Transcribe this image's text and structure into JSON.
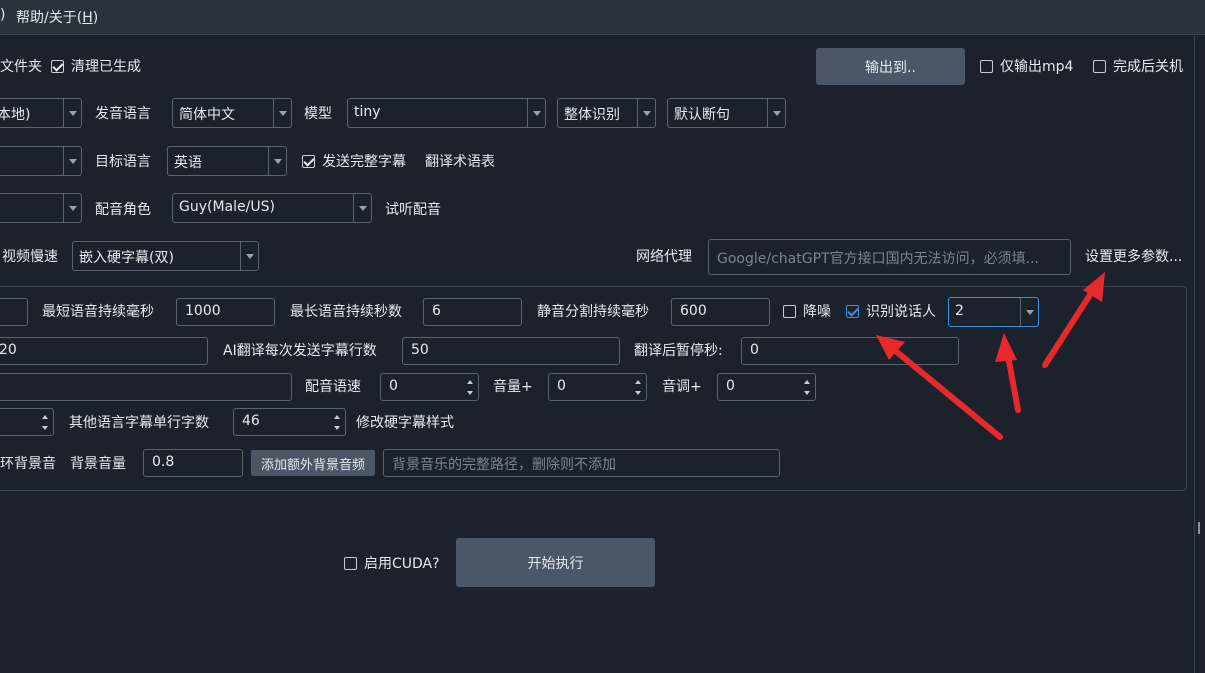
{
  "menubar": {
    "prefix": ")",
    "help": "帮助/关于(",
    "help_key": "H",
    "help_suffix": ")"
  },
  "row1": {
    "folder_label": "文件夹",
    "clean_checkbox": {
      "label": "清理已生成",
      "checked": true
    },
    "output_button": "输出到..",
    "only_mp4": {
      "label": "仅输出mp4",
      "checked": false
    },
    "shutdown": {
      "label": "完成后关机",
      "checked": false
    }
  },
  "row2": {
    "mode_combo": "本地)",
    "lang_label": "发音语言",
    "lang_combo": "简体中文",
    "model_label": "模型",
    "model_combo": "tiny",
    "recog_combo": "整体识别",
    "split_combo": "默认断句"
  },
  "row3": {
    "target_label": "目标语言",
    "target_combo": "英语",
    "send_full": {
      "label": "发送完整字幕",
      "checked": true
    },
    "glossary": "翻译术语表"
  },
  "row4": {
    "role_label": "配音角色",
    "role_combo": "Guy(Male/US)",
    "preview": "试听配音"
  },
  "row5": {
    "slow_label": "视频慢速",
    "subtitle_combo": "嵌入硬字幕(双)",
    "proxy_label": "网络代理",
    "proxy_placeholder": "Google/chatGPT官方接口国内无法访问，必须填...",
    "more_params": "设置更多参数..."
  },
  "row6": {
    "min_label": "最短语音持续毫秒",
    "min_value": "1000",
    "max_label": "最长语音持续秒数",
    "max_value": "6",
    "silence_label": "静音分割持续毫秒",
    "silence_value": "600",
    "denoise": {
      "label": "降噪",
      "checked": false
    },
    "speaker": {
      "label": "识别说话人",
      "checked": true
    },
    "speaker_combo": "2"
  },
  "row7": {
    "left_value": "20",
    "ai_label": "AI翻译每次发送字幕行数",
    "ai_value": "50",
    "pause_label": "翻译后暂停秒:",
    "pause_value": "0"
  },
  "row8": {
    "speed_label": "配音语速",
    "speed_value": "0",
    "volume_label": "音量+",
    "volume_value": "0",
    "pitch_label": "音调+",
    "pitch_value": "0"
  },
  "row9": {
    "other_label": "其他语言字幕单行字数",
    "other_value": "46",
    "style_link": "修改硬字幕样式"
  },
  "row10": {
    "loop_label": "环背景音",
    "bgvol_label": "背景音量",
    "bgvol_value": "0.8",
    "add_bg_button": "添加额外背景音频",
    "bg_path_placeholder": "背景音乐的完整路径，删除则不添加"
  },
  "footer": {
    "cuda": {
      "label": "启用CUDA?",
      "checked": false
    },
    "start_button": "开始执行"
  },
  "colors": {
    "background": "#1b222b",
    "button": "#4b5666",
    "border": "#5a6470",
    "accent": "#3d8fe0",
    "annotation": "#e8292b"
  }
}
